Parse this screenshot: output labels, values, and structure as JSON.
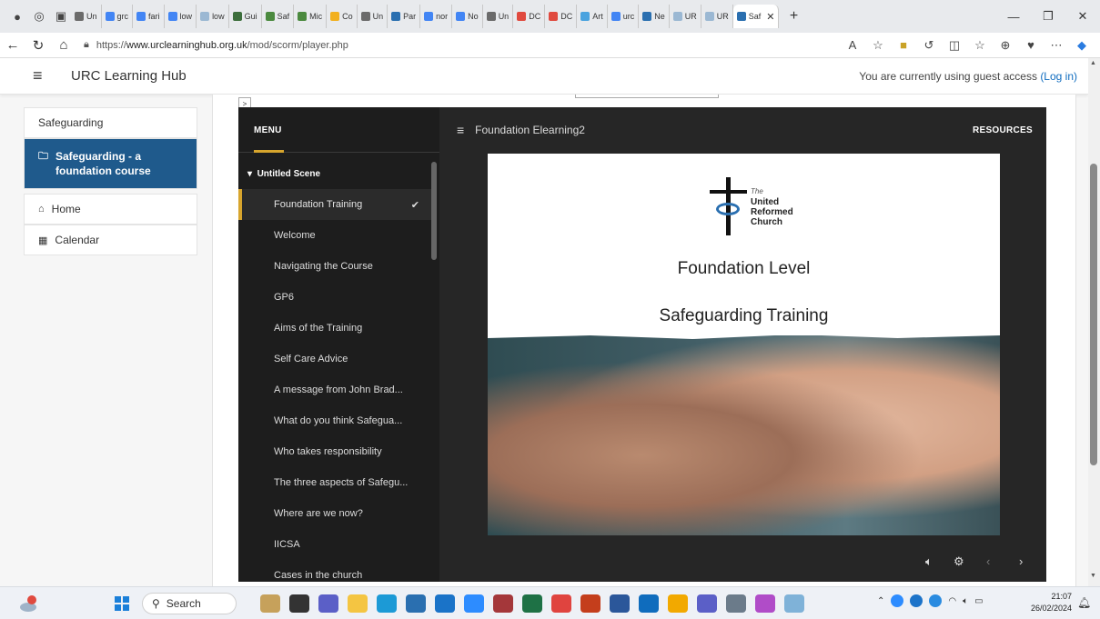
{
  "browser": {
    "tabs": [
      {
        "label": "Un",
        "color": "#6b6b6b"
      },
      {
        "label": "grc",
        "color": "#4285f4"
      },
      {
        "label": "fari",
        "color": "#4285f4"
      },
      {
        "label": "low",
        "color": "#4285f4"
      },
      {
        "label": "low",
        "color": "#9bb8d3"
      },
      {
        "label": "Gui",
        "color": "#3c6e3c"
      },
      {
        "label": "Saf",
        "color": "#4b8a3f"
      },
      {
        "label": "Mic",
        "color": "#4b8a3f"
      },
      {
        "label": "Co",
        "color": "#f2b01e"
      },
      {
        "label": "Un",
        "color": "#6b6b6b"
      },
      {
        "label": "Par",
        "color": "#2a6fb0"
      },
      {
        "label": "nor",
        "color": "#4285f4"
      },
      {
        "label": "No",
        "color": "#4285f4"
      },
      {
        "label": "Un",
        "color": "#6b6b6b"
      },
      {
        "label": "DC",
        "color": "#e04a3f"
      },
      {
        "label": "DC",
        "color": "#e04a3f"
      },
      {
        "label": "Art",
        "color": "#4aa3df"
      },
      {
        "label": "urc",
        "color": "#4285f4"
      },
      {
        "label": "Ne",
        "color": "#2a6fb0"
      },
      {
        "label": "UR",
        "color": "#9bb8d3"
      },
      {
        "label": "UR",
        "color": "#9bb8d3"
      }
    ],
    "active_tab": {
      "label": "Saf",
      "color": "#2a6fb0"
    },
    "url_prefix": "https://",
    "url_domain": "www.urclearninghub.org.uk",
    "url_path": "/mod/scorm/player.php"
  },
  "site": {
    "name": "URC Learning Hub",
    "guest_text": "You are currently using guest access",
    "login_link": "(Log in)"
  },
  "sidebar": {
    "section": "Safeguarding",
    "course": "Safeguarding - a foundation course",
    "home": "Home",
    "calendar": "Calendar"
  },
  "player": {
    "expander": ">",
    "menu_title": "MENU",
    "scene": "Untitled Scene",
    "menu_items": [
      "Foundation Training",
      "Welcome",
      "Navigating the Course",
      "GP6",
      "Aims of the Training",
      "Self Care Advice",
      "A message from John Brad...",
      "What do you think Safegua...",
      "Who takes responsibility",
      "The three aspects of Safegu...",
      "Where are we now?",
      "IICSA",
      "Cases in the church"
    ],
    "content_title": "Foundation Elearning2",
    "resources": "RESOURCES"
  },
  "slide": {
    "logo_the": "The",
    "logo_line1": "United",
    "logo_line2": "Reformed",
    "logo_line3": "Church",
    "heading1": "Foundation Level",
    "heading2": "Safeguarding Training"
  },
  "taskbar": {
    "search_label": "Search",
    "time": "21:07",
    "date": "26/02/2024"
  },
  "colors": {
    "accent_gold": "#d7a52d",
    "sidebar_active": "#1f5a8c",
    "link": "#0f6cbf"
  }
}
